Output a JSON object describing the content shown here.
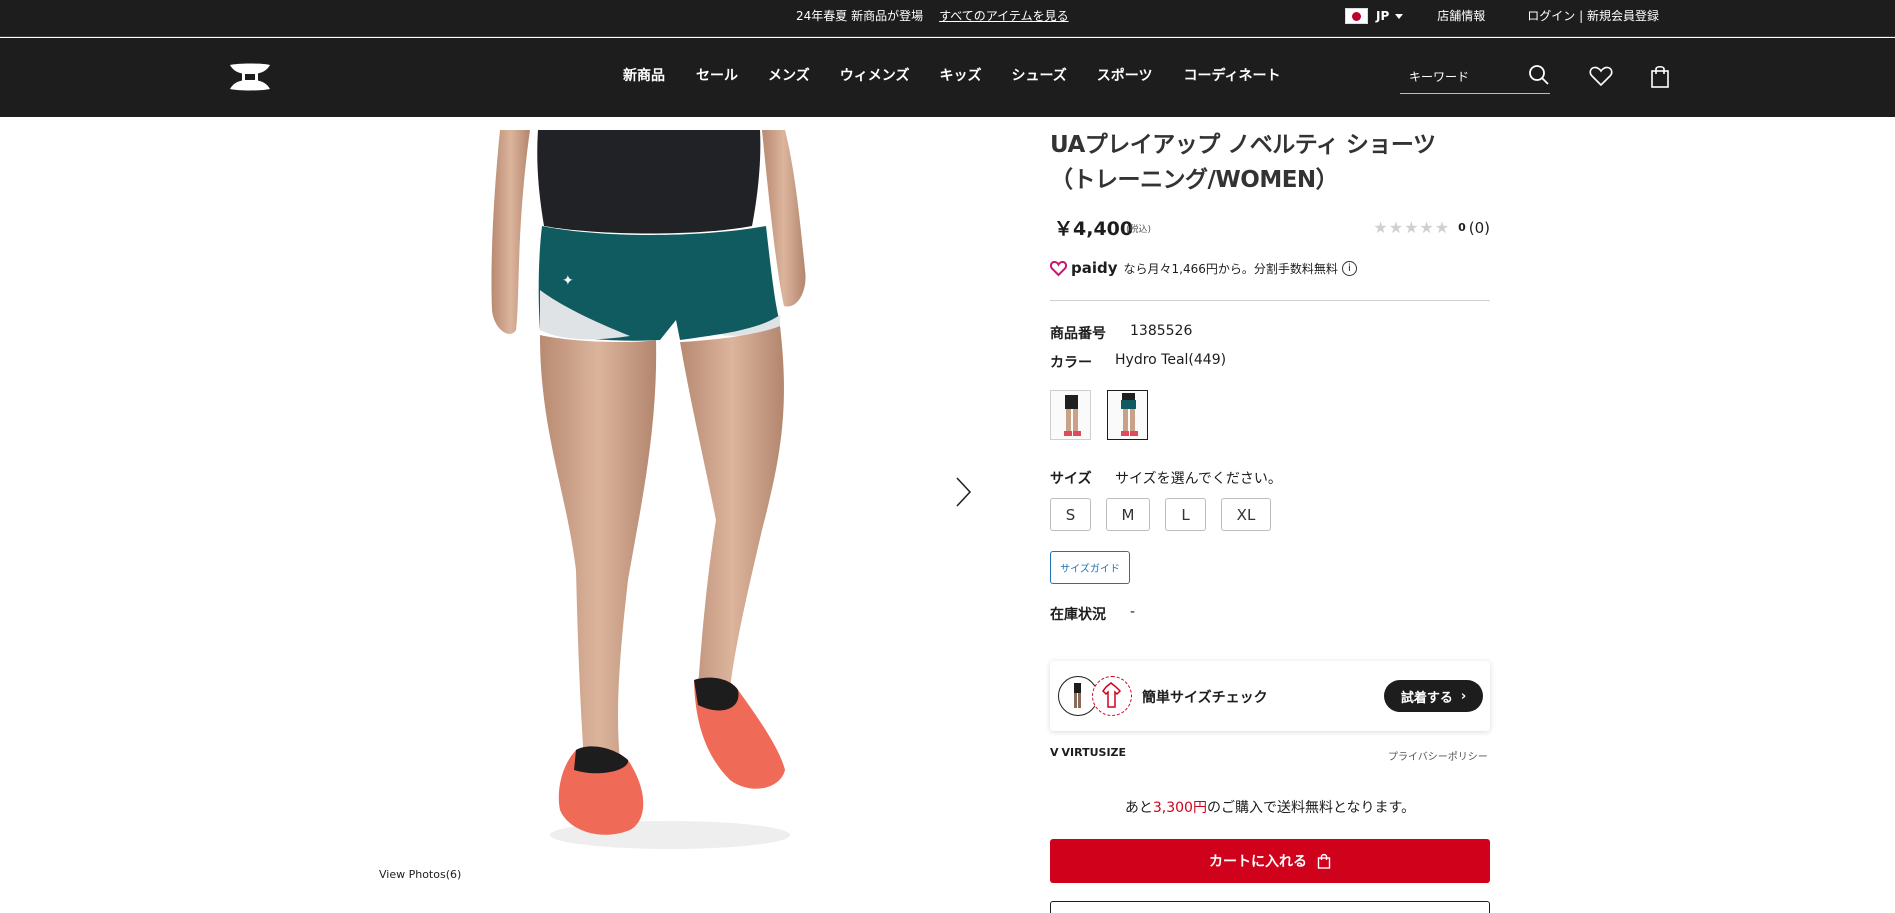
{
  "topbar": {
    "promo_text": "24年春夏 新商品が登場",
    "promo_link": "すべてのアイテムを見る",
    "country": "JP",
    "store_info": "店舗情報",
    "login": "ログイン | 新規会員登録"
  },
  "nav": {
    "items": [
      "新商品",
      "セール",
      "メンズ",
      "ウィメンズ",
      "キッズ",
      "シューズ",
      "スポーツ",
      "コーディネート"
    ],
    "search_placeholder": "キーワード"
  },
  "gallery": {
    "view_photos": "View Photos(6)"
  },
  "product": {
    "title_line1": "UAプレイアップ ノベルティ ショーツ",
    "title_line2": "（トレーニング/WOMEN）",
    "price": "￥4,400",
    "tax_note": "(税込)",
    "rating_count": "0",
    "review_count": "(0)",
    "rating_value": 0,
    "paidy_brand": "paidy",
    "paidy_text": "なら月々1,466円から。分割手数料無料",
    "sku_label": "商品番号",
    "sku_value": "1385526",
    "color_label": "カラー",
    "color_value": "Hydro Teal(449)",
    "size_label": "サイズ",
    "size_prompt": "サイズを選んでください。",
    "sizes": [
      "S",
      "M",
      "L",
      "XL"
    ],
    "size_guide": "サイズガイド",
    "stock_label": "在庫状況",
    "stock_value": "-"
  },
  "virtusize": {
    "title": "簡単サイズチェック",
    "try_button": "試着する",
    "logo_text": "VIRTUSIZE",
    "privacy": "プライバシーポリシー"
  },
  "shipping": {
    "prefix": "あと",
    "amount": "3,300円",
    "suffix": "のご購入で送料無料となります。"
  },
  "cart": {
    "add_to_cart": "カートに入れる"
  },
  "colors": {
    "topbar_bg": "#1d1d1d",
    "accent_red": "#d0021b",
    "link_blue": "#1a75b5",
    "shorts_teal": "#0f5b60"
  }
}
